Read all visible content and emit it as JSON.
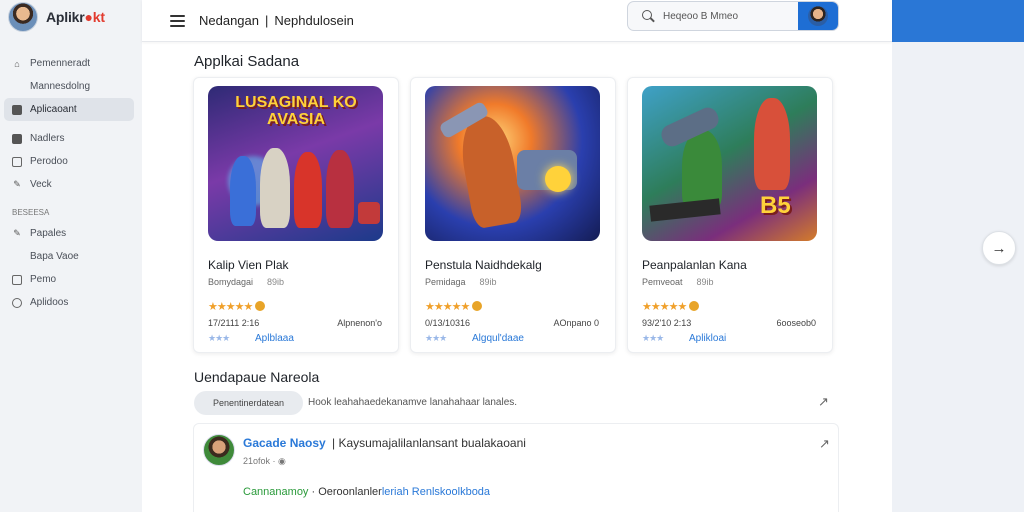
{
  "brand": {
    "name_main": "Aplikr",
    "name_accent": "●kt"
  },
  "sidebar": {
    "items": [
      {
        "label": "Pemenneradt",
        "icon": "house-icon"
      },
      {
        "label": "Mannesdolng",
        "icon": ""
      },
      {
        "label": "Aplicaoant",
        "icon": "apps-icon",
        "active": true
      },
      {
        "label": "Nadlers",
        "icon": "grid-icon"
      },
      {
        "label": "Perodoo",
        "icon": "box-icon"
      },
      {
        "label": "Veck",
        "icon": "pencil-icon"
      }
    ],
    "section_label": "BESEESA",
    "section_items": [
      {
        "label": "Papales",
        "icon": "pencil-icon"
      },
      {
        "label": "Bapa Vaoe",
        "icon": ""
      },
      {
        "label": "Pemo",
        "icon": "square-icon"
      },
      {
        "label": "Aplidoos",
        "icon": "circle-icon"
      }
    ]
  },
  "header": {
    "title_part1": "Nedangan",
    "separator": "|",
    "title_part2": "Nephdulosein",
    "search_placeholder": "Heqeoo B Mmeo"
  },
  "section1": {
    "title": "Applkai Sadana"
  },
  "cards": [
    {
      "name": "Kalip Vien Plak",
      "category": "Bomydagai",
      "size": "89ib",
      "stars": "★★★★★",
      "date": "17/2111 2:16",
      "downloads": "Alpnenon'o",
      "rating": "★★★",
      "link": "Aplblaaa",
      "art_text": "LUSAGINAL KO AVASIA"
    },
    {
      "name": "Penstula Naidhdekalg",
      "category": "Pemidaga",
      "size": "89ib",
      "stars": "★★★★★",
      "date": "0/13/10316",
      "downloads": "AOnpano 0",
      "rating": "★★★",
      "link": "Algqul'daae",
      "art_text": ""
    },
    {
      "name": "Peanpalanlan Kana",
      "category": "Pemveoat",
      "size": "89ib",
      "stars": "★★★★★",
      "date": "93/2'10 2:13",
      "downloads": "6ooseob0",
      "rating": "★★★",
      "link": "Aplikloai",
      "art_text": "B5"
    }
  ],
  "section2": {
    "title": "Uendapaue Nareola",
    "chip": "Penentinerdatean",
    "description": "Hook leahahaedekanamve lanahahaar lanales."
  },
  "post": {
    "author": "Gacade Naosy",
    "text": "| Kaysumajalilanlansant bualakaoani",
    "meta": "21ofok · ◉",
    "line2_green": "Cannanamoy",
    "line2_mid": " · Oeroonlanler",
    "line2_blue": "leriah Renlskoolkboda"
  },
  "colors": {
    "accent": "#2a77d6",
    "link": "#2a79d8",
    "star": "#f0a02a"
  }
}
